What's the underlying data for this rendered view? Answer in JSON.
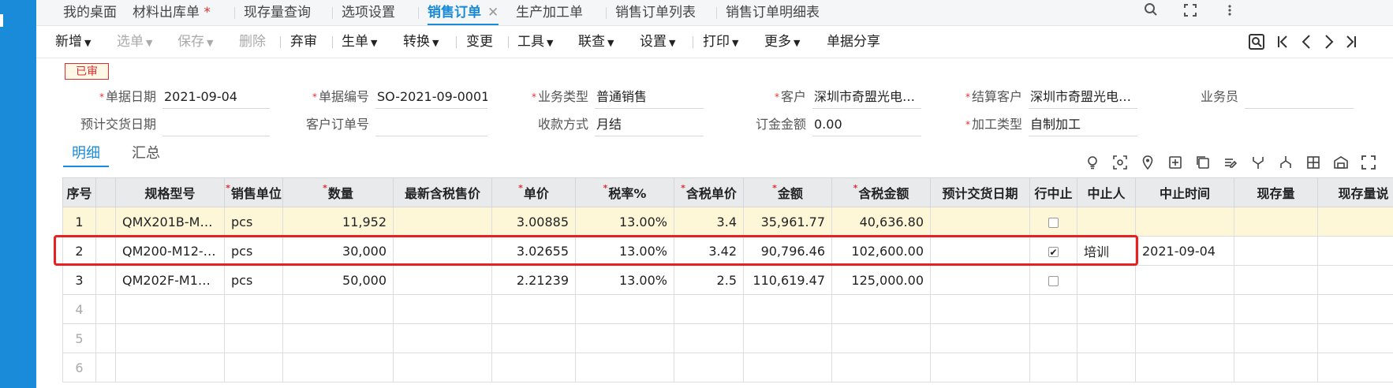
{
  "tabs": [
    {
      "label": "我的桌面"
    },
    {
      "label": "材料出库单",
      "modified": "*"
    },
    {
      "label": "现存量查询"
    },
    {
      "label": "选项设置"
    },
    {
      "label": "销售订单",
      "close": "✕"
    },
    {
      "label": "生产加工单"
    },
    {
      "label": "销售订单列表"
    },
    {
      "label": "销售订单明细表"
    }
  ],
  "toolbar": {
    "new": "新增",
    "select": "选单",
    "save": "保存",
    "delete": "删除",
    "abandon": "弃审",
    "generate": "生单",
    "convert": "转换",
    "change": "变更",
    "tools": "工具",
    "linked": "联查",
    "settings": "设置",
    "print": "打印",
    "more": "更多",
    "share": "单据分享"
  },
  "status": "已审",
  "form": {
    "doc_date": {
      "label": "单据日期",
      "value": "2021-09-04"
    },
    "doc_no": {
      "label": "单据编号",
      "value": "SO-2021-09-0001"
    },
    "biz_type": {
      "label": "业务类型",
      "value": "普通销售"
    },
    "customer": {
      "label": "客户",
      "value": "深圳市奇盟光电…"
    },
    "settle_customer": {
      "label": "结算客户",
      "value": "深圳市奇盟光电…"
    },
    "salesman": {
      "label": "业务员",
      "value": ""
    },
    "delivery_date": {
      "label": "预计交货日期",
      "value": ""
    },
    "customer_order": {
      "label": "客户订单号",
      "value": ""
    },
    "payment": {
      "label": "收款方式",
      "value": "月结"
    },
    "deposit": {
      "label": "订金金额",
      "value": "0.00"
    },
    "process_type": {
      "label": "加工类型",
      "value": "自制加工"
    }
  },
  "subtabs": {
    "detail": "明细",
    "summary": "汇总"
  },
  "table": {
    "columns": [
      "序号",
      "",
      "规格型号",
      "销售单位",
      "数量",
      "最新含税售价",
      "单价",
      "税率%",
      "含税单价",
      "金额",
      "含税金额",
      "预计交货日期",
      "行中止",
      "中止人",
      "中止时间",
      "现存量",
      "现存量说"
    ],
    "rows": [
      {
        "seq": "1",
        "spec": "QMX201B-M8…",
        "unit": "pcs",
        "qty": "11,952",
        "latest": "",
        "price": "3.00885",
        "tax": "13.00%",
        "tax_price": "3.4",
        "amount": "35,961.77",
        "tax_amount": "40,636.80",
        "delivery": "",
        "stopped": "",
        "stopper": "",
        "stop_time": "",
        "stock": "",
        "stock_desc": ""
      },
      {
        "seq": "2",
        "spec": "QM200-M12-…",
        "unit": "pcs",
        "qty": "30,000",
        "latest": "",
        "price": "3.02655",
        "tax": "13.00%",
        "tax_price": "3.42",
        "amount": "90,796.46",
        "tax_amount": "102,600.00",
        "delivery": "",
        "stopped": "✔",
        "stopper": "培训",
        "stop_time": "2021-09-04",
        "stock": "",
        "stock_desc": ""
      },
      {
        "seq": "3",
        "spec": "QM202F-M12…",
        "unit": "pcs",
        "qty": "50,000",
        "latest": "",
        "price": "2.21239",
        "tax": "13.00%",
        "tax_price": "2.5",
        "amount": "110,619.47",
        "tax_amount": "125,000.00",
        "delivery": "",
        "stopped": "",
        "stopper": "",
        "stop_time": "",
        "stock": "",
        "stock_desc": ""
      }
    ],
    "empty_rows": [
      "4",
      "5",
      "6"
    ]
  },
  "colors": {
    "accent": "#1a8bd8",
    "highlight": "#e82020",
    "selected_row": "#fdf7d8"
  }
}
